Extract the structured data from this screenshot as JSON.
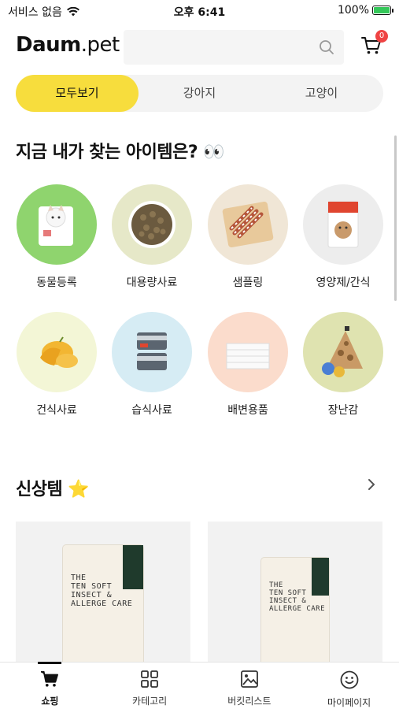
{
  "status_bar": {
    "carrier": "서비스 없음",
    "time": "오후 6:41",
    "battery_percent": "100%"
  },
  "header": {
    "logo_bold": "Daum",
    "logo_light": ".pet",
    "cart_count": "0"
  },
  "tabs": [
    {
      "label": "모두보기",
      "active": true
    },
    {
      "label": "강아지",
      "active": false
    },
    {
      "label": "고양이",
      "active": false
    }
  ],
  "finder": {
    "title": "지금 내가 찾는 아이템은? 👀",
    "categories": [
      {
        "label": "동물등록",
        "bg": "#8fd46e"
      },
      {
        "label": "대용량사료",
        "bg": "#e6e8c8"
      },
      {
        "label": "샘플링",
        "bg": "#f0e6d6"
      },
      {
        "label": "영양제/간식",
        "bg": "#ededed"
      },
      {
        "label": "건식사료",
        "bg": "#f3f6d6"
      },
      {
        "label": "습식사료",
        "bg": "#d6ecf4"
      },
      {
        "label": "배변용품",
        "bg": "#fbdccc"
      },
      {
        "label": "장난감",
        "bg": "#dfe3b0"
      }
    ]
  },
  "new_items": {
    "title": "신상템 ⭐",
    "products": [
      {
        "bag_text": "THE\nTEN SOFT\nINSECT &\nALLERGE CARE"
      },
      {
        "bag_text": "THE\nTEN SOFT\nINSECT &\nALLERGE CARE"
      }
    ]
  },
  "bottom_nav": [
    {
      "label": "쇼핑",
      "icon": "cart-icon",
      "active": true
    },
    {
      "label": "카테고리",
      "icon": "grid-icon",
      "active": false
    },
    {
      "label": "버킷리스트",
      "icon": "image-icon",
      "active": false
    },
    {
      "label": "마이페이지",
      "icon": "smile-icon",
      "active": false
    }
  ]
}
